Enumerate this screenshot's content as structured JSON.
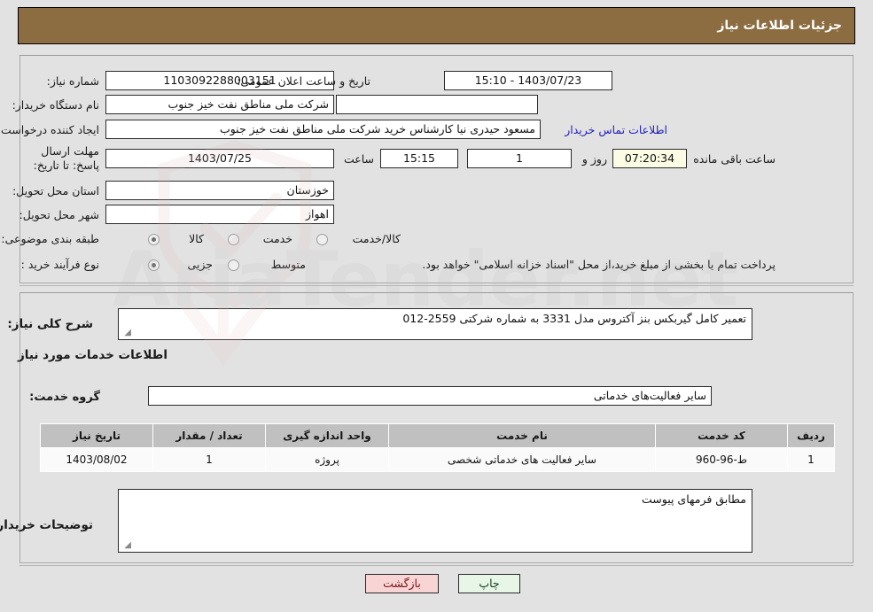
{
  "header": {
    "title": "جزئیات اطلاعات نیاز"
  },
  "top_section": {
    "need_number_label": "شماره نیاز:",
    "need_number_value": "1103092288003151",
    "buyer_org_label": "نام دستگاه خریدار:",
    "buyer_org_value": "شرکت ملی مناطق نفت خیز جنوب",
    "requester_label": "ایجاد کننده درخواست:",
    "requester_value": "مسعود حیدری نیا کارشناس خرید شرکت ملی مناطق نفت خیز جنوب",
    "deadline_label": "مهلت ارسال پاسخ: تا تاریخ:",
    "deadline_date": "1403/07/25",
    "deadline_hour_label": "ساعت",
    "deadline_time": "15:15",
    "province_label": "استان محل تحویل:",
    "province_value": "خوزستان",
    "city_label": "شهر محل تحویل:",
    "city_value": "اهواز",
    "announce_label": "تاریخ و ساعت اعلان عمومی:",
    "announce_value": "1403/07/23 - 15:10",
    "empty_field_value": "",
    "contact_link": "اطلاعات تماس خریدار",
    "remaining_days": "1",
    "remaining_days_label": "روز و",
    "remaining_clock": "07:20:34",
    "remaining_suffix": "ساعت باقی مانده",
    "category_label": "طبقه بندی موضوعی:",
    "category_options": [
      {
        "label": "کالا",
        "selected": false
      },
      {
        "label": "خدمت",
        "selected": true
      },
      {
        "label": "کالا/خدمت",
        "selected": false
      }
    ],
    "process_label": "نوع فرآیند خرید :",
    "process_options": [
      {
        "label": "جزیی",
        "selected": true
      },
      {
        "label": "متوسط",
        "selected": false
      }
    ],
    "treasury_checkbox_label": "پرداخت تمام یا بخشی از مبلغ خرید،از محل \"اسناد خزانه اسلامی\" خواهد بود."
  },
  "summary": {
    "label": "شرح کلی نیاز:",
    "value": "تعمیر کامل گیربکس بنز آکتروس مدل 3331 به شماره شرکتی 2559-012"
  },
  "services": {
    "heading": "اطلاعات خدمات مورد نیاز",
    "group_label": "گروه خدمت:",
    "group_value": "سایر فعالیت‌های خدماتی",
    "table": {
      "columns": [
        "ردیف",
        "کد خدمت",
        "نام خدمت",
        "واحد اندازه گیری",
        "تعداد / مقدار",
        "تاریخ نیاز"
      ],
      "rows": [
        {
          "row": "1",
          "code": "ط-96-960",
          "name": "سایر فعالیت های خدماتی شخصی",
          "unit": "پروژه",
          "qty": "1",
          "date": "1403/08/02"
        }
      ]
    }
  },
  "buyer_notes": {
    "label": "توضیحات خریدار:",
    "value": "مطابق فرمهای پیوست"
  },
  "footer": {
    "print_label": "چاپ",
    "back_label": "بازگشت"
  },
  "watermark": {
    "text": "AriaTender.net"
  },
  "colors": {
    "header_bg": "#8c6d41",
    "page_bg": "#e2e2e2",
    "table_header_bg": "#c0c0c0",
    "link": "#2222bb",
    "print_btn_bg": "#e8f6e8",
    "back_btn_bg": "#f8d4d4"
  }
}
